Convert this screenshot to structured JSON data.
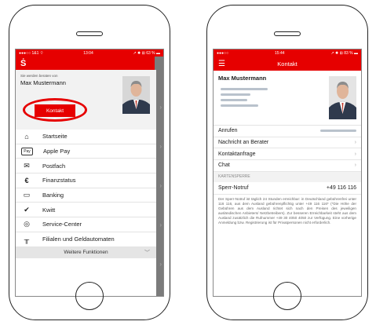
{
  "left_screen": {
    "status": {
      "carrier": "●●●○○ 1&1 ⌔",
      "time": "13:04",
      "battery": "↗ ✹ ⊞ 63 % ▬"
    },
    "logo": "Ṡ",
    "advisor": {
      "subtitle": "Sie werden beraten von",
      "name": "Max Mustermann",
      "contact_button": "Kontakt"
    },
    "menu": [
      {
        "icon": "home-icon",
        "glyph": "⌂",
        "label": "Startseite"
      },
      {
        "icon": "apple-pay-icon",
        "glyph": "Pay",
        "label": "Apple Pay"
      },
      {
        "icon": "mail-icon",
        "glyph": "✉",
        "label": "Postfach"
      },
      {
        "icon": "euro-icon",
        "glyph": "€",
        "label": "Finanzstatus"
      },
      {
        "icon": "bank-card-icon",
        "glyph": "▭",
        "label": "Banking"
      },
      {
        "icon": "kwitt-icon",
        "glyph": "✔",
        "label": "Kwitt"
      },
      {
        "icon": "service-icon",
        "glyph": "◎",
        "label": "Service-Center"
      },
      {
        "icon": "atm-icon",
        "glyph": "╥",
        "label": "Filialen und Geldautomaten"
      }
    ],
    "more_label": "Weitere Funktionen",
    "accent": "#e60000"
  },
  "right_screen": {
    "status": {
      "carrier": "●●●○○",
      "time": "15:44",
      "battery": "↗ ✹ ⊞ 83 % ▬"
    },
    "title": "Kontakt",
    "advisor_name": "Max Mustermann",
    "rows": [
      {
        "label": "Anrufen",
        "chevron": false
      },
      {
        "label": "Nachricht an Berater",
        "chevron": true
      },
      {
        "label": "Kontaktanfrage",
        "chevron": true
      },
      {
        "label": "Chat",
        "chevron": true
      }
    ],
    "section_label": "KARTENSPERRE",
    "sperr_label": "Sperr-Notruf",
    "sperr_number": "+49 116 116",
    "sperr_text": "Der Sperr-Notruf ist täglich 24 Stunden erreichbar: in Deutschland gebührenfrei unter 116 116, aus dem Ausland gebührenpflichtig unter +49 116 116* (*Die Höhe der Gebühren aus dem Ausland richtet sich nach den Preisen des jeweiligen ausländischen Anbieters/ Netzbetreibers). Zur besseren Erreichbarkeit steht aus dem Ausland zusätzlich die Rufnummer +49 30 4050 4050 zur Verfügung. Eine vorherige Anmeldung bzw. Registrierung ist für Privatpersonen nicht erforderlich."
  }
}
